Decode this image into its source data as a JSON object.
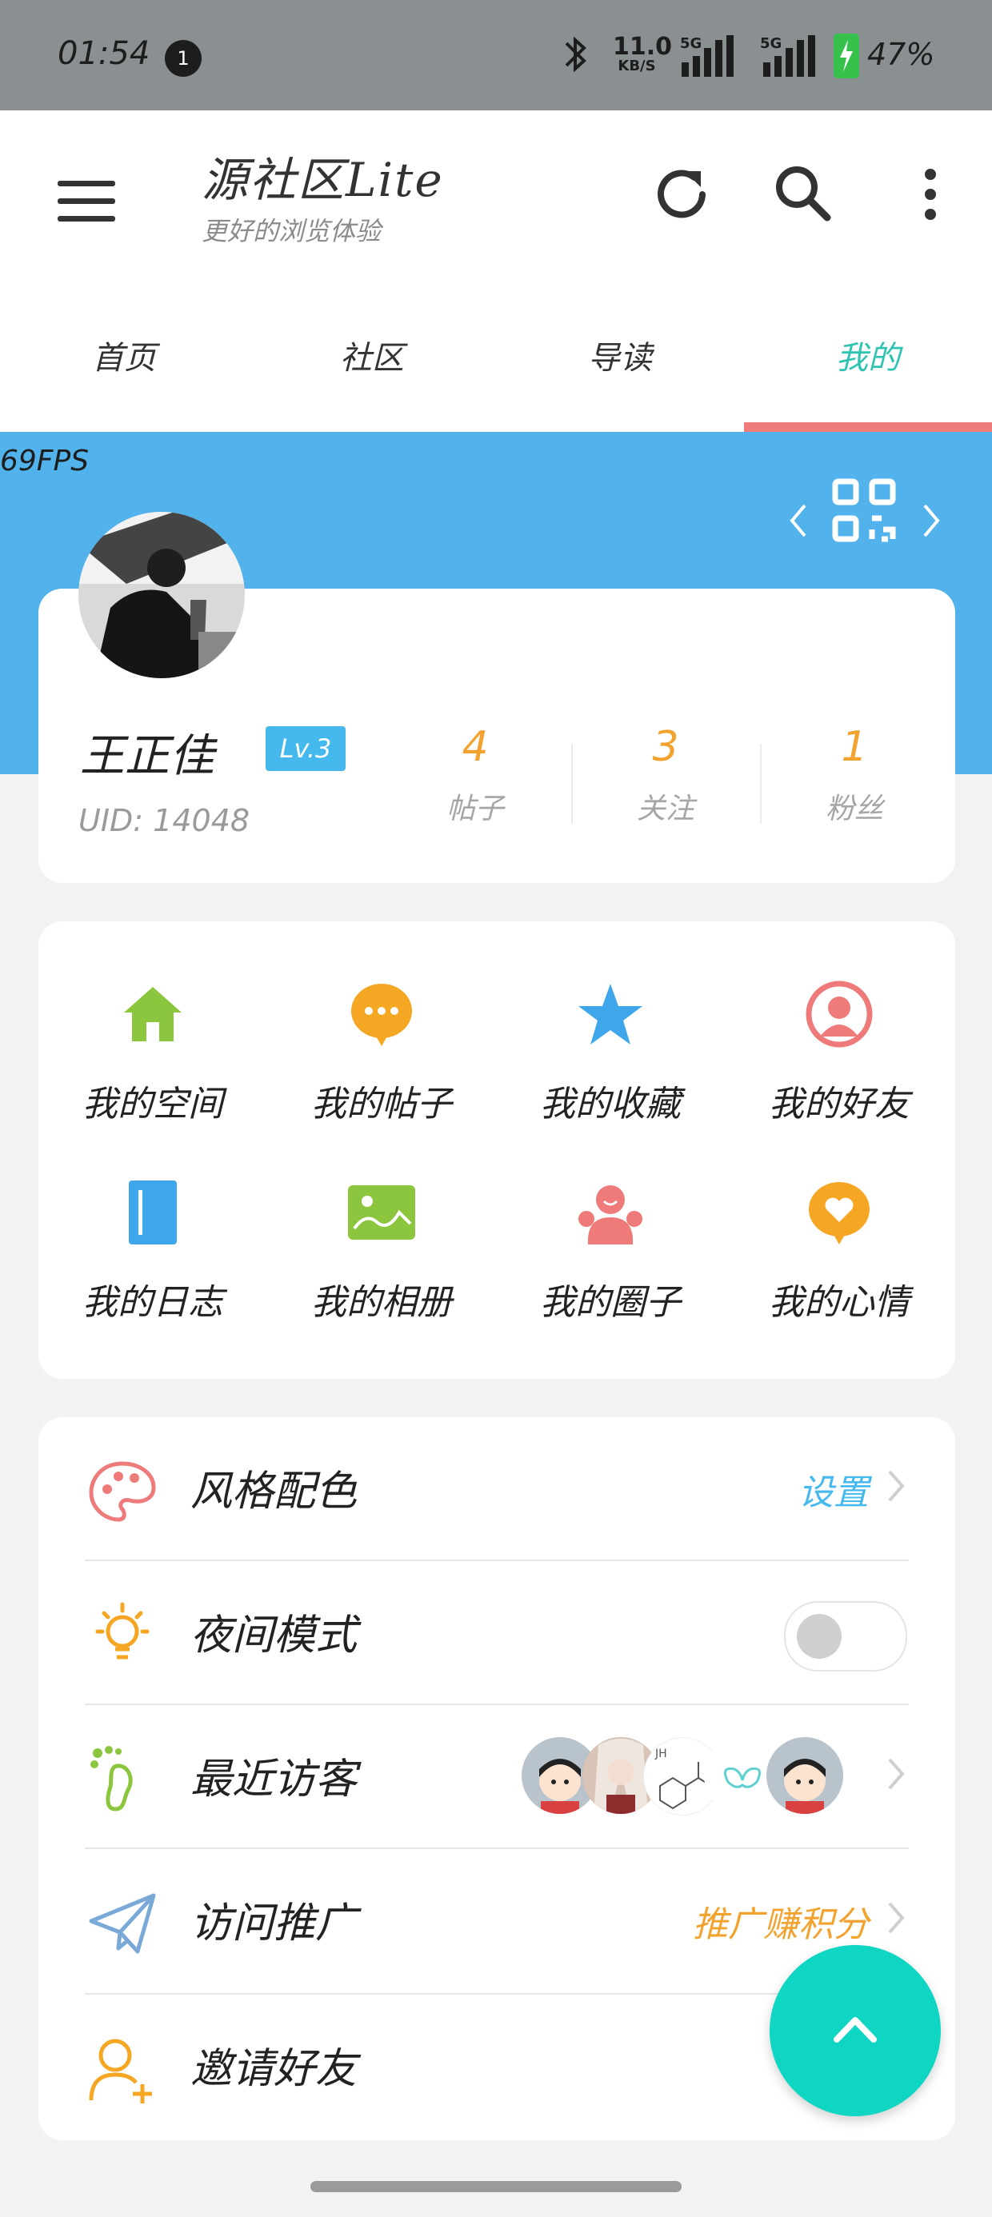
{
  "status_bar": {
    "time": "01:54",
    "notification_count": "1",
    "net_speed_value": "11.0",
    "net_speed_unit": "KB/S",
    "signal1_label": "5G",
    "signal2_label": "5G",
    "battery": "47%"
  },
  "header": {
    "title": "源社区Lite",
    "subtitle": "更好的浏览体验",
    "icons": [
      "menu-icon",
      "refresh-icon",
      "search-icon",
      "more-icon"
    ]
  },
  "tabs": [
    {
      "label": "首页",
      "active": false
    },
    {
      "label": "社区",
      "active": false
    },
    {
      "label": "导读",
      "active": false
    },
    {
      "label": "我的",
      "active": true
    }
  ],
  "fps_overlay": "69FPS",
  "profile": {
    "name": "王正佳",
    "level": "Lv.3",
    "uid": "UID: 14048",
    "stats": [
      {
        "value": "4",
        "label": "帖子"
      },
      {
        "value": "3",
        "label": "关注"
      },
      {
        "value": "1",
        "label": "粉丝"
      }
    ]
  },
  "grid": [
    {
      "label": "我的空间",
      "icon": "home-icon",
      "color": "#8cc63f"
    },
    {
      "label": "我的帖子",
      "icon": "chat-bubble-icon",
      "color": "#f5a623"
    },
    {
      "label": "我的收藏",
      "icon": "star-icon",
      "color": "#3ea6ea"
    },
    {
      "label": "我的好友",
      "icon": "user-circle-icon",
      "color": "#ee7a7a"
    },
    {
      "label": "我的日志",
      "icon": "notebook-icon",
      "color": "#3ea6ea"
    },
    {
      "label": "我的相册",
      "icon": "image-icon",
      "color": "#8cc63f"
    },
    {
      "label": "我的圈子",
      "icon": "group-icon",
      "color": "#ee7a7a"
    },
    {
      "label": "我的心情",
      "icon": "heart-bubble-icon",
      "color": "#f5a623"
    }
  ],
  "settings": {
    "style": {
      "label": "风格配色",
      "action": "设置",
      "icon": "palette-icon"
    },
    "night": {
      "label": "夜间模式",
      "enabled": false,
      "icon": "bulb-icon"
    },
    "visitors": {
      "label": "最近访客",
      "icon": "footprint-icon",
      "count": 4
    },
    "promote": {
      "label": "访问推广",
      "action": "推广赚积分",
      "icon": "paper-plane-icon"
    },
    "invite": {
      "label": "邀请好友",
      "icon": "add-user-icon"
    }
  },
  "colors": {
    "accent": "#2fc4b2",
    "banner": "#52b3ec",
    "tab_indicator": "#f07b7b",
    "stat_number": "#f2a32f",
    "fab": "#0fd5c3"
  }
}
